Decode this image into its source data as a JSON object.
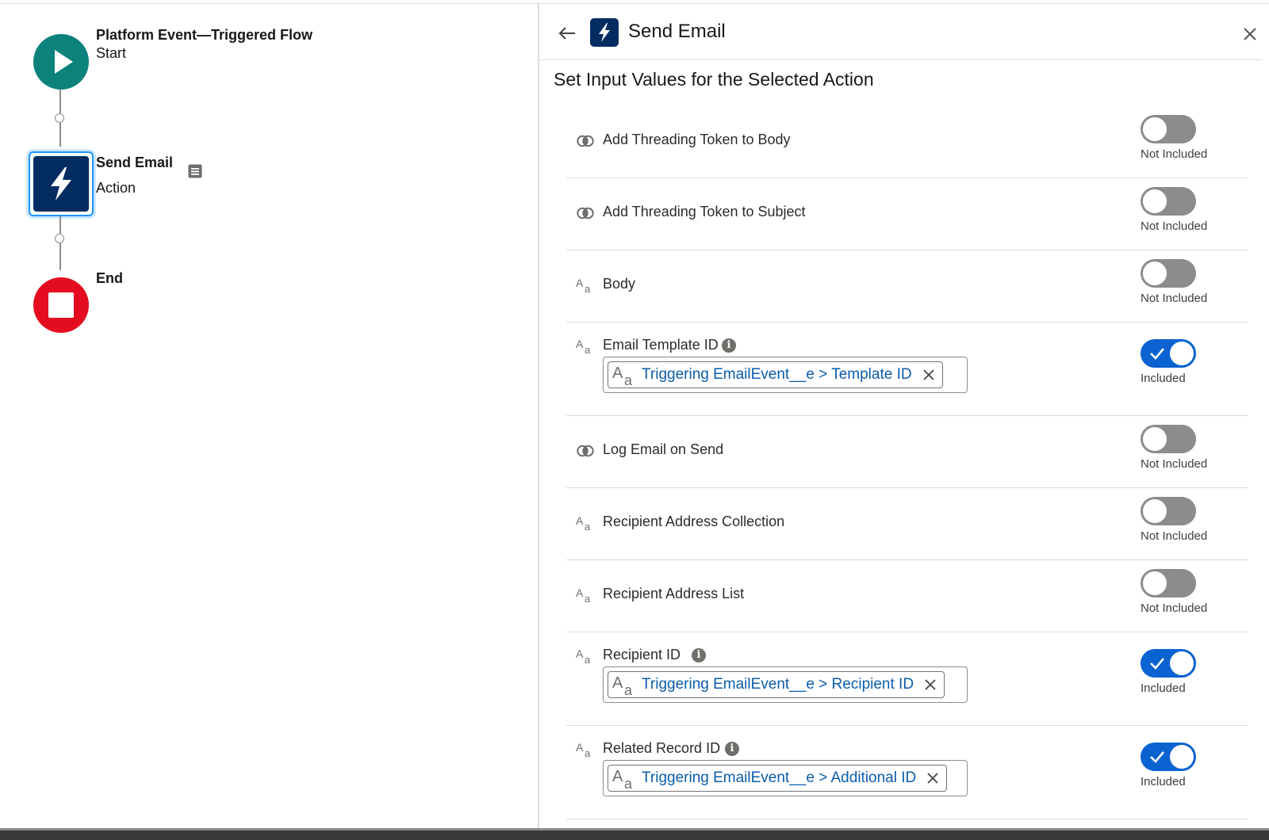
{
  "canvas": {
    "start": {
      "title": "Platform Event—Triggered Flow",
      "subtitle": "Start"
    },
    "action": {
      "title": "Send Email",
      "subtitle": "Action"
    },
    "end": {
      "title": "End"
    }
  },
  "panel": {
    "title": "Send Email",
    "subtitle": "Set Input Values for the Selected Action",
    "fields": [
      {
        "label": "Add Threading Token to Body",
        "type_icon": "boolean-icon",
        "included": false,
        "status": "Not Included"
      },
      {
        "label": "Add Threading Token to Subject",
        "type_icon": "boolean-icon",
        "included": false,
        "status": "Not Included"
      },
      {
        "label": "Body",
        "type_icon": "text-icon",
        "included": false,
        "status": "Not Included"
      },
      {
        "label": "Email Template ID",
        "type_icon": "text-icon",
        "info": true,
        "included": true,
        "status": "Included",
        "value": "Triggering EmailEvent__e > Template ID"
      },
      {
        "label": "Log Email on Send",
        "type_icon": "boolean-icon",
        "included": false,
        "status": "Not Included"
      },
      {
        "label": "Recipient Address Collection",
        "type_icon": "text-icon",
        "included": false,
        "status": "Not Included"
      },
      {
        "label": "Recipient Address List",
        "type_icon": "text-icon",
        "included": false,
        "status": "Not Included"
      },
      {
        "label": "Recipient ID",
        "type_icon": "text-icon",
        "info": true,
        "included": true,
        "status": "Included",
        "value": "Triggering EmailEvent__e > Recipient ID"
      },
      {
        "label": "Related Record ID",
        "type_icon": "text-icon",
        "info": true,
        "included": true,
        "status": "Included",
        "value": "Triggering EmailEvent__e > Additional ID"
      }
    ]
  },
  "colors": {
    "start_node": "#0b827c",
    "action_node": "#032d60",
    "end_node": "#e40d1f",
    "toggle_on": "#0b63d1",
    "toggle_off": "#8c8c8c",
    "link_text": "#0b5cab"
  }
}
